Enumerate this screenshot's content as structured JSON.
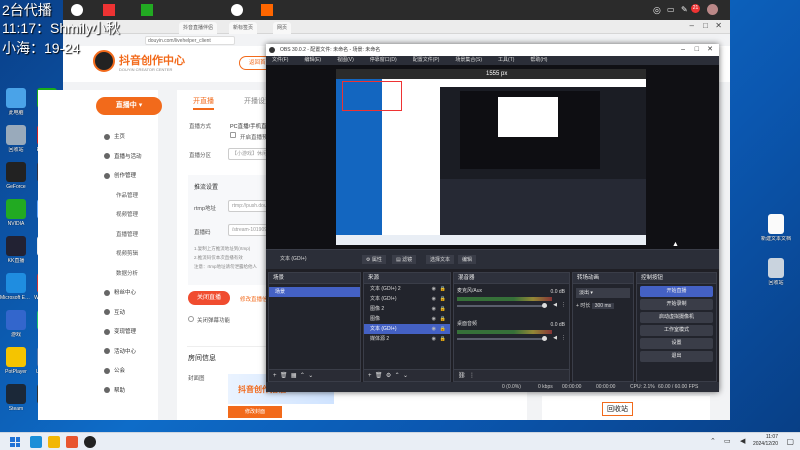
{
  "overlay": {
    "line1": "2台代播",
    "line2": "11:17：Shmily小秋",
    "line3": "小海：19-24"
  },
  "desktop_left_icons": [
    {
      "label": "此电脑",
      "color": "#4aa3e8"
    },
    {
      "label": "微信",
      "color": "#1aad19"
    },
    {
      "label": "回收站",
      "color": "#9ab"
    },
    {
      "label": "Elements",
      "color": "#c22"
    },
    {
      "label": "GeForce",
      "color": "#222"
    },
    {
      "label": "DaVinci",
      "color": "#334"
    },
    {
      "label": "NVIDIA",
      "color": "#2a2"
    },
    {
      "label": "文件",
      "color": "#6af"
    },
    {
      "label": "KK直播",
      "color": "#223"
    },
    {
      "label": "文档",
      "color": "#eee"
    },
    {
      "label": "Microsoft Edge",
      "color": "#1f8de0"
    },
    {
      "label": "WPS Office",
      "color": "#c33"
    },
    {
      "label": "游戏",
      "color": "#36c"
    },
    {
      "label": "KOOK",
      "color": "#1ec36f"
    },
    {
      "label": "PotPlayer",
      "color": "#f5c400"
    },
    {
      "label": "UU加速器",
      "color": "#57a"
    },
    {
      "label": "Steam",
      "color": "#1b2838"
    },
    {
      "label": "OBS",
      "color": "#333"
    }
  ],
  "desktop_right_icon": {
    "label": "新建文本文档"
  },
  "desktop_right_icon2": {
    "label": "回收站"
  },
  "browser": {
    "tab1": "抖音直播伴侣",
    "tab2": "新标签页",
    "tab3": "网页",
    "address": "douyin.com/livehelper_client",
    "notif_badge": "21"
  },
  "site": {
    "logo_text": "抖音创作中心",
    "logo_sub": "DOUYIN CREATOR CENTER",
    "header_btn": "返回首页",
    "live_button": "直播中",
    "nav": [
      {
        "label": "主页",
        "sub": false
      },
      {
        "label": "直播与活动",
        "sub": false
      },
      {
        "label": "创作管理",
        "sub": false
      },
      {
        "label": "作品管理",
        "sub": true
      },
      {
        "label": "视频管理",
        "sub": true
      },
      {
        "label": "直播管理",
        "sub": true
      },
      {
        "label": "视频剪辑",
        "sub": true
      },
      {
        "label": "数据分析",
        "sub": true
      },
      {
        "label": "粉丝中心",
        "sub": false
      },
      {
        "label": "互动",
        "sub": false
      },
      {
        "label": "变现管理",
        "sub": false
      },
      {
        "label": "活动中心",
        "sub": false
      },
      {
        "label": "公会",
        "sub": false
      },
      {
        "label": "帮助",
        "sub": false
      }
    ],
    "tab_active": "开直播",
    "tab_other": "开播设置",
    "field_stream_type": "直播方式",
    "field_stream_value": "PC直播/手机直播",
    "checkbox_label": "开启直播预览",
    "field_category": "直播分区",
    "field_category_value": "【小游戏】休闲",
    "push_section": "推流设置",
    "field_rtmp": "rtmp地址",
    "field_rtmp_value": "rtmp://push.douyin.com",
    "field_key": "直播码",
    "field_key_value": "/stream-1019099",
    "tip1": "1.复制上方推流地址到(rtmp)",
    "tip2": "2.推流码仅本次直播有效",
    "tip3": "注意：rtmp地址请勿泄露给他人",
    "close_live": "关闭直播",
    "modify_live": "修改直播信息",
    "radio_label": "关闭弹幕功能",
    "room_info": "房间信息",
    "cover_label": "封面图",
    "card_text": "抖音创作播福",
    "card_btn": "修改封面"
  },
  "obs": {
    "title": "OBS 30.0.2 - 配置文件: 未命名 - 场景: 未命名",
    "menu": [
      "文件(F)",
      "编辑(E)",
      "视图(V)",
      "停靠窗口(D)",
      "配置文件(P)",
      "场景集合(S)",
      "工具(T)",
      "帮助(H)"
    ],
    "preview_size": "1555 px",
    "toolbar": {
      "source_label": "文本 (GDI+)",
      "props": "属性",
      "filters": "滤镜",
      "text_value": "选择文本",
      "edit": "编辑"
    },
    "scenes_title": "场景",
    "scenes": [
      "场景"
    ],
    "sources_title": "来源",
    "sources": [
      {
        "name": "文本 (GDI+) 2",
        "sel": false
      },
      {
        "name": "文本 (GDI+)",
        "sel": false
      },
      {
        "name": "图像 2",
        "sel": false
      },
      {
        "name": "图像",
        "sel": false
      },
      {
        "name": "文本 (GDI+)",
        "sel": true
      },
      {
        "name": "媒体源 2",
        "sel": false
      }
    ],
    "mixer_title": "混音器",
    "mixer": [
      {
        "name": "麦克风/Aux",
        "db": "0.0 dB"
      },
      {
        "name": "桌面音频",
        "db": "0.0 dB"
      }
    ],
    "transitions_title": "转场动画",
    "transition": "淡出",
    "duration_label": "时长",
    "duration": "300 ms",
    "controls_title": "控制按钮",
    "controls": [
      {
        "label": "开始直播",
        "primary": true
      },
      {
        "label": "开始录制",
        "primary": false
      },
      {
        "label": "启动虚拟摄像机",
        "primary": false
      },
      {
        "label": "工作室模式",
        "primary": false
      },
      {
        "label": "设置",
        "primary": false
      },
      {
        "label": "退出",
        "primary": false
      }
    ],
    "status": {
      "dropped": "0 (0.0%)",
      "net": "0 kbps",
      "live_time": "00:00:00",
      "rec_time": "00:00:00",
      "cpu": "CPU: 2.1%",
      "fps": "60.00 / 60.00 FPS"
    }
  },
  "qr_text": "回收站",
  "taskbar": {
    "time": "11:07",
    "date": "2024/12/20"
  }
}
